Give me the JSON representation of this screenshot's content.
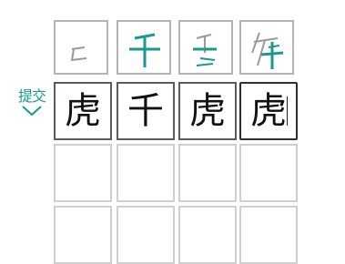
{
  "submit": {
    "label": "提交",
    "accent": "#1a9a8e"
  },
  "answer_row": {
    "chars": [
      "虎",
      "千",
      "虎",
      "虎"
    ],
    "active_index": 3
  },
  "hint_row": {
    "stroke_color": "#1a9a8e",
    "gray_color": "#9a9a9a",
    "items": [
      {
        "name": "stroke-hint-1"
      },
      {
        "name": "stroke-hint-2"
      },
      {
        "name": "stroke-hint-3"
      },
      {
        "name": "stroke-hint-4"
      }
    ]
  },
  "empty_rows": 2
}
